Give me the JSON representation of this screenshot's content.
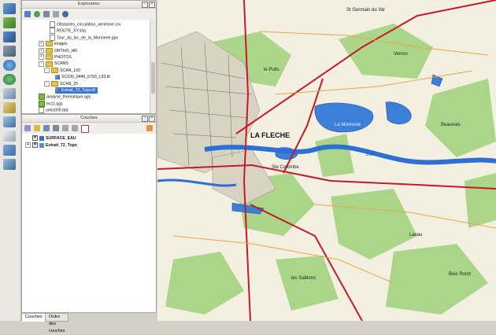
{
  "explorer": {
    "title": "Explorateur",
    "items": [
      {
        "label": "Obstacles_circulation_aerienne.csv",
        "type": "file",
        "indent": 5
      },
      {
        "label": "ROUTE_XY.shp",
        "type": "file",
        "indent": 5
      },
      {
        "label": "Tour_du_lac_de_la_Monnerie.gpx",
        "type": "file",
        "indent": 5
      },
      {
        "label": "images",
        "type": "folder",
        "indent": 3,
        "exp": "+"
      },
      {
        "label": "ORTHO_HR",
        "type": "folder",
        "indent": 3,
        "exp": "+"
      },
      {
        "label": "PHOTOS",
        "type": "folder",
        "indent": 3,
        "exp": "+"
      },
      {
        "label": "SCANS",
        "type": "folder",
        "indent": 3,
        "exp": "-"
      },
      {
        "label": "SCAN_100",
        "type": "folder",
        "indent": 4,
        "exp": "-"
      },
      {
        "label": "SC100_0440_6750_L93.tif",
        "type": "raster",
        "indent": 6
      },
      {
        "label": "SCAN_25",
        "type": "folder",
        "indent": 4,
        "exp": "-"
      },
      {
        "label": "Extrait_72_Topo.tif",
        "type": "raster",
        "indent": 6,
        "selected": true
      },
      {
        "label": "analyse_thematique.qgs",
        "type": "qgs",
        "indent": 3
      },
      {
        "label": "ex11.qgs",
        "type": "qgs",
        "indent": 3
      },
      {
        "label": "umis000.dat",
        "type": "file",
        "indent": 3
      }
    ]
  },
  "layers": {
    "title": "Couches",
    "items": [
      {
        "label": "SURFACE_EAU",
        "checked": true,
        "color": "#2e6fd6"
      },
      {
        "label": "Extrait_72_Topo",
        "checked": true,
        "color": "#5b8bc9"
      }
    ]
  },
  "tabs": [
    "Couches",
    "Ordre des couches"
  ],
  "map": {
    "labels": [
      {
        "text": "St Germain du Val"
      },
      {
        "text": "LA FLECHE"
      },
      {
        "text": "Ste Colombe"
      },
      {
        "text": "Loir"
      },
      {
        "text": "Verron"
      },
      {
        "text": "La Monnerie"
      },
      {
        "text": "Beauvais"
      },
      {
        "text": "Lavau"
      },
      {
        "text": "Bois Rond"
      },
      {
        "text": "le Puits"
      },
      {
        "text": "les Sablons"
      }
    ]
  }
}
